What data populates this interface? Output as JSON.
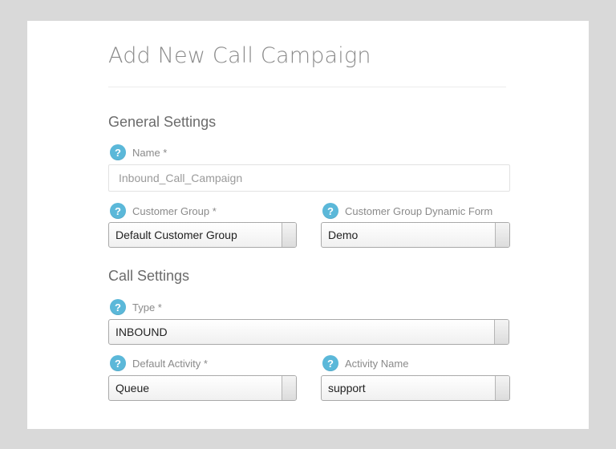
{
  "page": {
    "title": "Add New Call Campaign"
  },
  "general_settings": {
    "heading": "General Settings",
    "name": {
      "label": "Name *",
      "value": "Inbound_Call_Campaign"
    },
    "customer_group": {
      "label": "Customer Group *",
      "value": "Default Customer Group"
    },
    "customer_group_dynamic_form": {
      "label": "Customer Group Dynamic Form",
      "value": "Demo"
    }
  },
  "call_settings": {
    "heading": "Call Settings",
    "type": {
      "label": "Type *",
      "value": "INBOUND"
    },
    "default_activity": {
      "label": "Default Activity *",
      "value": "Queue"
    },
    "activity_name": {
      "label": "Activity Name",
      "value": "support"
    }
  },
  "icons": {
    "help": "help-question-icon",
    "help_glyph": "?"
  },
  "colors": {
    "background": "#d9d9d9",
    "card": "#ffffff",
    "help_icon": "#5bb8d9",
    "title_text": "#8a8a8a"
  }
}
